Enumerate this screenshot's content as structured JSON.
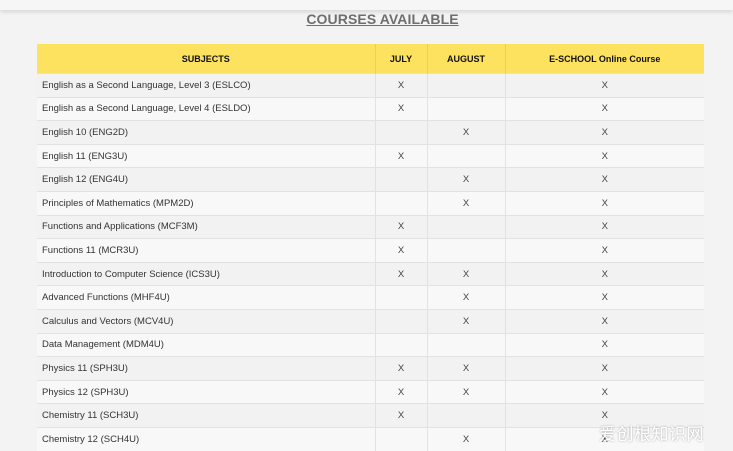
{
  "heading": "COURSES AVAILABLE",
  "table": {
    "headers": [
      "SUBJECTS",
      "JULY",
      "AUGUST",
      "E-SCHOOL Online Course"
    ],
    "rows": [
      [
        "English as a Second Language, Level 3 (ESLCO)",
        "X",
        "",
        "X"
      ],
      [
        "English as a Second Language, Level 4 (ESLDO)",
        "X",
        "",
        "X"
      ],
      [
        "English 10 (ENG2D)",
        "",
        "X",
        "X"
      ],
      [
        "English 11 (ENG3U)",
        "X",
        "",
        "X"
      ],
      [
        "English 12 (ENG4U)",
        "",
        "X",
        "X"
      ],
      [
        "Principles of Mathematics (MPM2D)",
        "",
        "X",
        "X"
      ],
      [
        "Functions and Applications (MCF3M)",
        "X",
        "",
        "X"
      ],
      [
        "Functions 11 (MCR3U)",
        "X",
        "",
        "X"
      ],
      [
        "Introduction to Computer Science (ICS3U)",
        "X",
        "X",
        "X"
      ],
      [
        "Advanced Functions (MHF4U)",
        "",
        "X",
        "X"
      ],
      [
        "Calculus and Vectors (MCV4U)",
        "",
        "X",
        "X"
      ],
      [
        "Data Management (MDM4U)",
        "",
        "",
        "X"
      ],
      [
        "Physics 11 (SPH3U)",
        "X",
        "X",
        "X"
      ],
      [
        "Physics 12 (SPH3U)",
        "X",
        "X",
        "X"
      ],
      [
        "Chemistry 11 (SCH3U)",
        "X",
        "",
        "X"
      ],
      [
        "Chemistry 12 (SCH4U)",
        "",
        "X",
        "X"
      ]
    ]
  },
  "watermark": "爱创根知识网",
  "colors": {
    "header_bg": "#fde25f",
    "page_bg": "#f3f3f3"
  }
}
